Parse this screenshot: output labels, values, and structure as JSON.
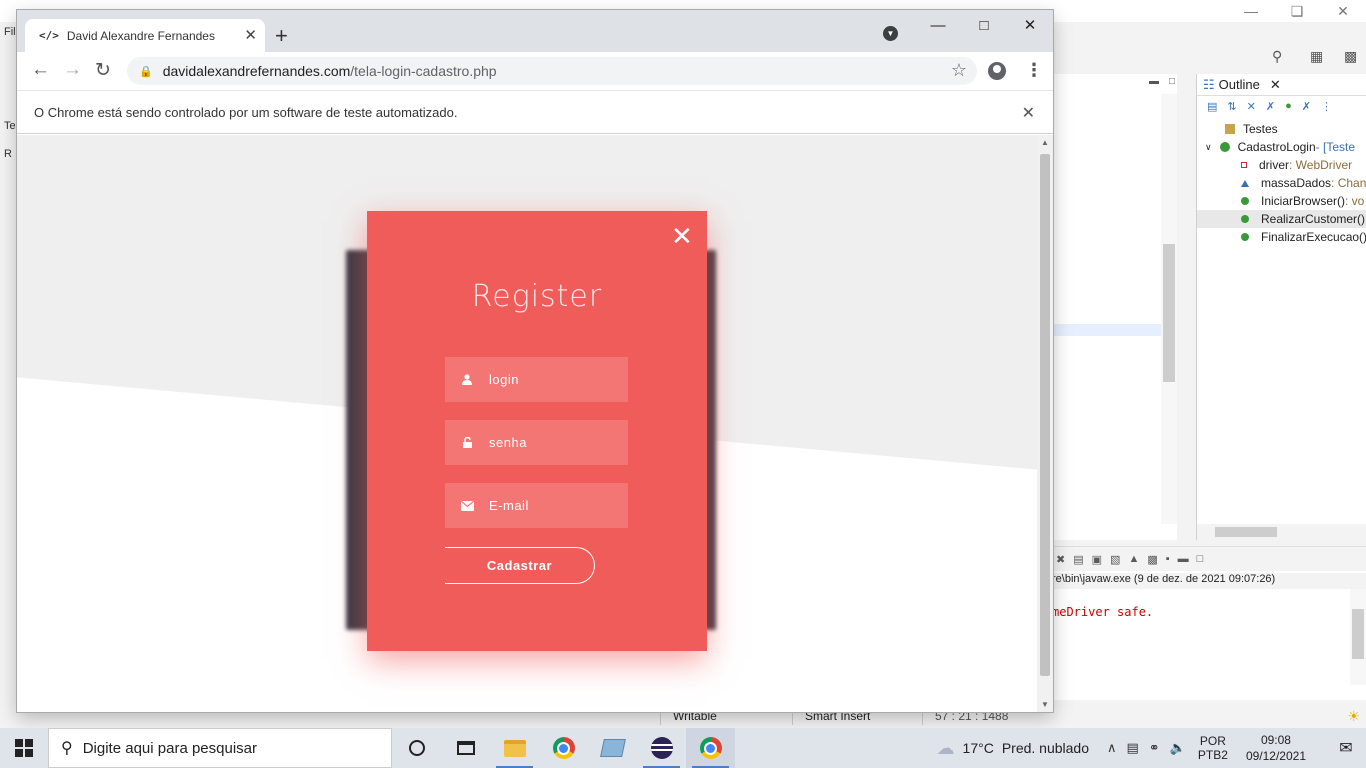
{
  "chrome": {
    "tab_title": "David Alexandre Fernandes",
    "tab_favicon": "</>",
    "url_host": "davidalexandrefernandes.com",
    "url_path": "/tela-login-cadastro.php",
    "infobar_text": "O Chrome está sendo controlado por um software de teste automatizado."
  },
  "modal": {
    "title": "Register",
    "fields": [
      {
        "placeholder": "login",
        "icon": "user-icon"
      },
      {
        "placeholder": "senha",
        "icon": "lock-icon"
      },
      {
        "placeholder": "E-mail",
        "icon": "envelope-icon"
      }
    ],
    "submit_label": "Cadastrar",
    "accent_color": "#f05c5a",
    "shadow_card_color": "#3b3a44"
  },
  "eclipse": {
    "outline": {
      "tab_title": "Outline",
      "items": [
        {
          "name": "Testes",
          "type": ""
        },
        {
          "name": "CadastroLogin",
          "type": " - [Teste"
        },
        {
          "name": "driver",
          "type": " : WebDriver"
        },
        {
          "name": "massaDados",
          "type": " : Chan"
        },
        {
          "name": "IniciarBrowser()",
          "type": " : vo"
        },
        {
          "name": "RealizarCustomer()",
          "type": ""
        },
        {
          "name": "FinalizarExecucao()",
          "type": ""
        }
      ]
    },
    "console": {
      "path_text": "re\\bin\\javaw.exe  (9 de dez. de 2021 09:07:26)",
      "message": "meDriver safe."
    },
    "status": {
      "writable": "Writable",
      "insert_mode": "Smart Insert",
      "position": "57 : 21 : 1488"
    },
    "left_labels": [
      "Fil",
      "Tes",
      "R"
    ]
  },
  "taskbar": {
    "search_placeholder": "Digite aqui para pesquisar",
    "weather_temp": "17°C",
    "weather_text": "Pred. nublado",
    "lang_line1": "POR",
    "lang_line2": "PTB2",
    "time": "09:08",
    "date": "09/12/2021"
  }
}
